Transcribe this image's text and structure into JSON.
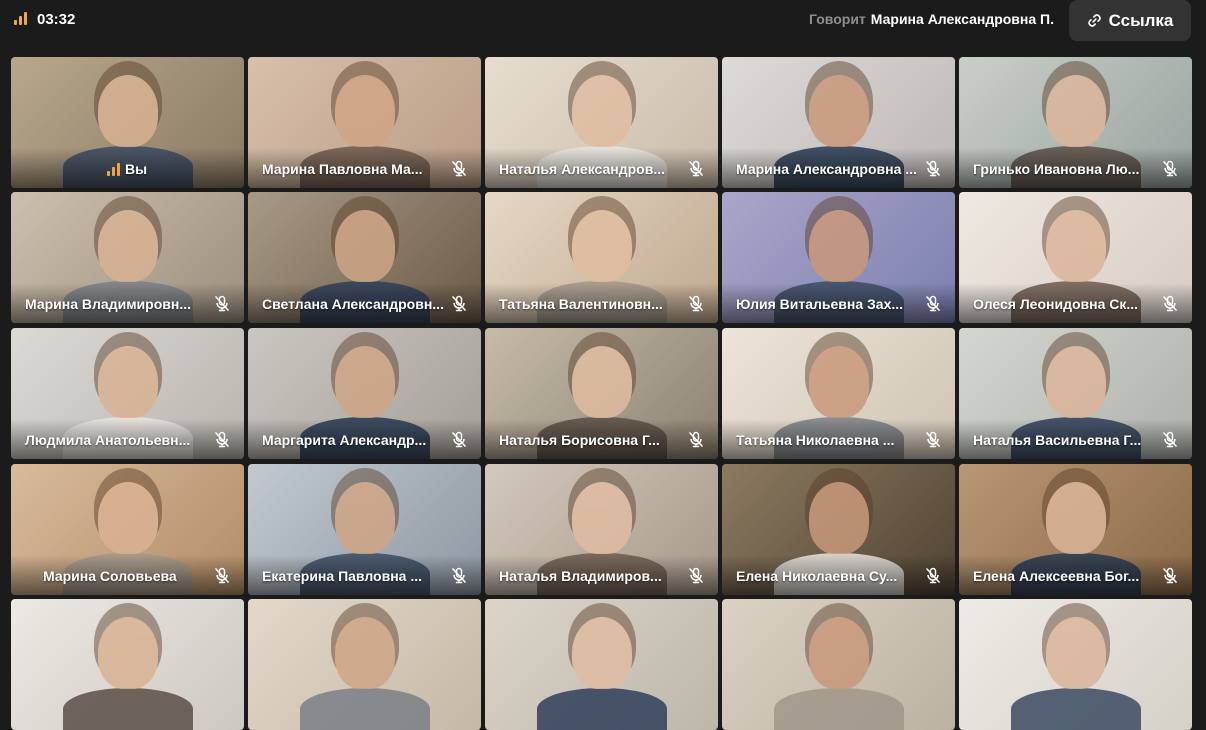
{
  "status_bar": {
    "time": "03:32",
    "speaking_label": "Говорит",
    "speaking_name": "Марина Александровна П.",
    "link_button": "Ссылка"
  },
  "you_label": "Вы",
  "participants": [
    "Марина Павловна Ма...",
    "Наталья Александров...",
    "Марина Александровна ...",
    "Гринько Ивановна Лю...",
    "Марина Владимировн...",
    "Светлана Александровн...",
    "Татьяна Валентиновн...",
    "Юлия Витальевна Зах...",
    "Олеся Леонидовна Ск...",
    "Людмила Анатольевн...",
    "Маргарита Александр...",
    "Наталья Борисовна Г...",
    "Татьяна Николаевна ...",
    "Наталья Васильевна Г...",
    "Марина Соловьева",
    "Екатерина Павловна ...",
    "Наталья Владимиров...",
    "Елена Николаевна Су...",
    "Елена Алексеевна Бог..."
  ],
  "colors": {
    "background": "#1b1b1b",
    "button_bg": "#333333",
    "signal": "#f2a53a",
    "speaking_label": "#8f8f8f"
  },
  "icons": {
    "signal": "signal-strength-icon",
    "link": "link-icon",
    "muted": "mic-off-icon"
  }
}
